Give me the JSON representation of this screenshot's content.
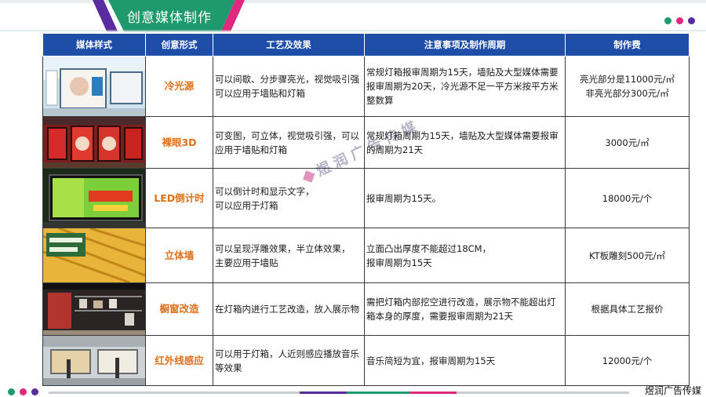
{
  "header": {
    "title": "创意媒体制作",
    "colors": {
      "band": "#1f9a6f",
      "accent_pink": "#e0287f",
      "accent_purple": "#5b2ca0"
    }
  },
  "table": {
    "columns": [
      "媒体样式",
      "创意形式",
      "工艺及效果",
      "注意事项及制作周期",
      "制作费"
    ],
    "rows": [
      {
        "image_icon": "light-box-corridor-image",
        "form": "冷光源",
        "process": "可以间歇、分步骤亮光，视觉吸引强可以应用于墙贴和灯箱",
        "notes": "常规灯箱报审周期为15天，墙贴及大型媒体需要报审周期为20天，冷光源不足一平方米按平方米整数算",
        "fee_lines": [
          "亮光部分是11000元/㎡",
          "非亮光部分300元/㎡"
        ]
      },
      {
        "image_icon": "naked-eye-3d-image",
        "form": "裸眼3D",
        "process": "可变图，可立体，视觉吸引强，可以应用于墙贴和灯箱",
        "notes": "常规灯箱周期为15天，墙贴及大型媒体需要报审的周期为21天",
        "fee_lines": [
          "3000元/㎡"
        ]
      },
      {
        "image_icon": "led-countdown-image",
        "form": "LED倒计时",
        "process_lines": [
          "可以倒计时和显示文字，",
          "可以应用于灯箱"
        ],
        "notes": "报审周期为15天。",
        "fee_lines": [
          "18000元/个"
        ]
      },
      {
        "image_icon": "3d-wall-image",
        "form": "立体墙",
        "process_lines": [
          "可以呈现浮雕效果，半立体效果，",
          "主要应用于墙贴"
        ],
        "notes_lines": [
          "立面凸出厚度不能超过18CM，",
          "报审周期为15天"
        ],
        "fee_lines": [
          "KT板雕刻500元/㎡"
        ]
      },
      {
        "image_icon": "shop-window-image",
        "form": "橱窗改造",
        "process": "在灯箱内进行工艺改造，放入展示物",
        "notes": "需把灯箱内部挖空进行改造，展示物不能超出灯箱本身的厚度，需要报审周期为21天",
        "fee_lines": [
          "根据具体工艺报价"
        ]
      },
      {
        "image_icon": "infrared-sensor-image",
        "form": "红外线感应",
        "process": "可以用于灯箱，人近则感应播放音乐等效果",
        "notes": "音乐简短为宜，报审周期为15天",
        "fee_lines": [
          "12000元/个"
        ]
      }
    ]
  },
  "watermark": {
    "text": "煜润广告传媒"
  },
  "footer": {
    "brand": "煜润广告传媒"
  },
  "colors": {
    "table_header": "#1f4ea8",
    "form_text": "#e0701a"
  }
}
